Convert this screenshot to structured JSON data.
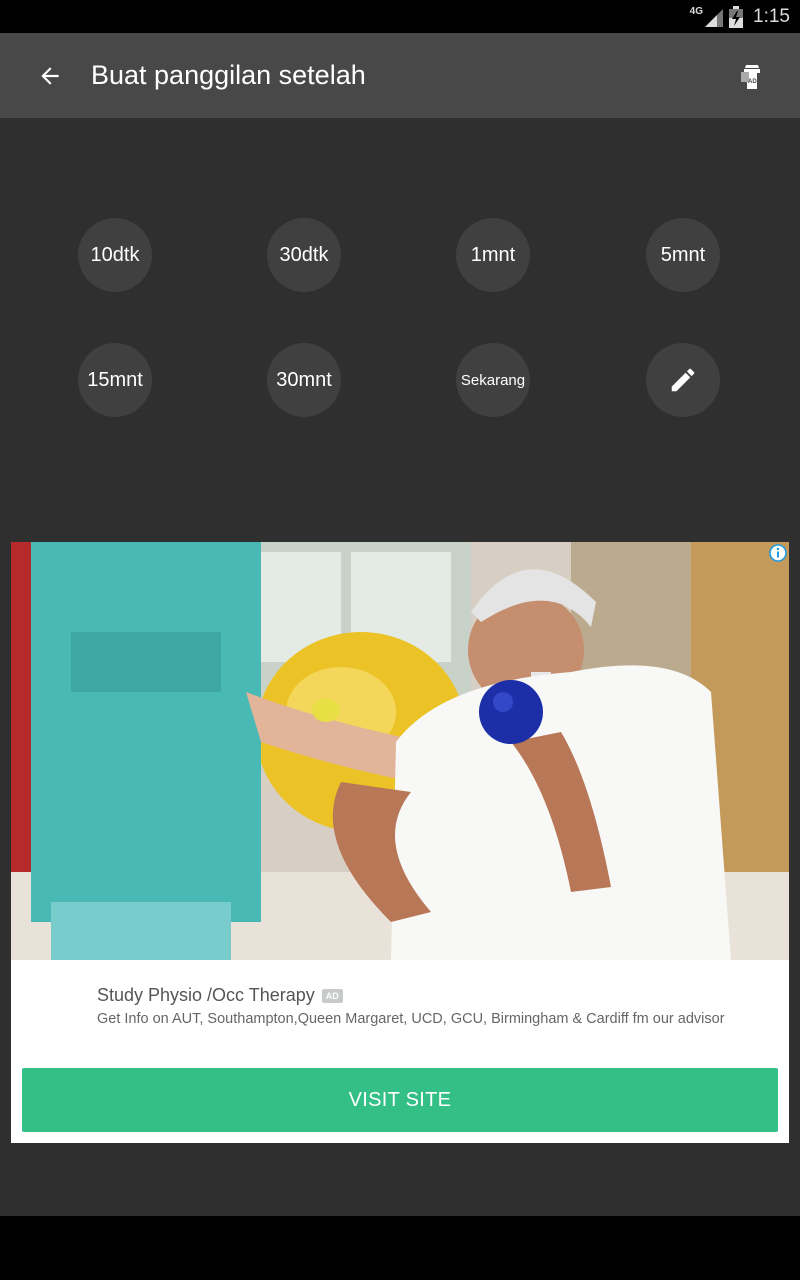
{
  "status_bar": {
    "network": "4G",
    "time": "1:15"
  },
  "app_bar": {
    "title": "Buat panggilan setelah"
  },
  "options": [
    {
      "label": "10dtk"
    },
    {
      "label": "30dtk"
    },
    {
      "label": "1mnt"
    },
    {
      "label": "5mnt"
    },
    {
      "label": "15mnt"
    },
    {
      "label": "30mnt"
    },
    {
      "label": "Sekarang"
    },
    {
      "icon": "pencil-icon"
    }
  ],
  "ad": {
    "headline": "Study Physio /Occ Therapy",
    "badge": "AD",
    "description": "Get Info on AUT, Southampton,Queen Margaret, UCD, GCU, Birmingham & Cardiff fm our advisor",
    "cta": "VISIT SITE",
    "image_icon": "ad-photo-therapist-patient",
    "info_icon": "info-icon"
  },
  "colors": {
    "app_bar": "#474847",
    "background": "#2f2f2f",
    "option_circle": "#404040",
    "cta": "#33bf85",
    "ad_info": "#1f9be0"
  }
}
